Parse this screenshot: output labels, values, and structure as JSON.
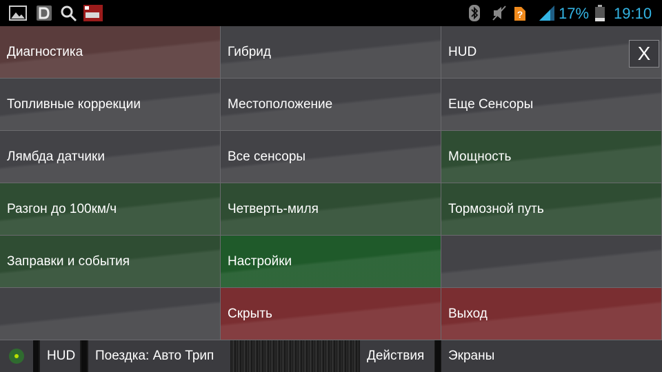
{
  "status_bar": {
    "battery_percent": "17%",
    "time": "19:10",
    "icons": [
      "image-icon",
      "d-app-icon",
      "search-icon",
      "game-thumbnail-icon",
      "bluetooth-icon",
      "mute-icon",
      "sim-unknown-icon",
      "signal-icon",
      "battery-icon"
    ]
  },
  "menu": {
    "rows": [
      [
        "Диагностика",
        "Гибрид",
        "HUD"
      ],
      [
        "Топливные коррекции",
        "Местоположение",
        "Еще Сенсоры"
      ],
      [
        "Лямбда датчики",
        "Все сенсоры",
        "Мощность"
      ],
      [
        "Разгон до 100км/ч",
        "Четверть-миля",
        "Тормозной путь"
      ],
      [
        "Заправки и события",
        "Настройки",
        ""
      ],
      [
        "",
        "Скрыть",
        "Выход"
      ]
    ]
  },
  "close_button": {
    "label": "X"
  },
  "bottom_bar": {
    "hud_label": "HUD",
    "trip_label": "Поездка: Авто Трип",
    "actions_label": "Действия",
    "screens_label": "Экраны",
    "indicator_color": "#7ab800"
  },
  "colors": {
    "accent": "#33b5e5",
    "gray": "#434347",
    "brown": "#5a3c3c",
    "green": "#2f4d33",
    "red": "#7a2e31"
  }
}
